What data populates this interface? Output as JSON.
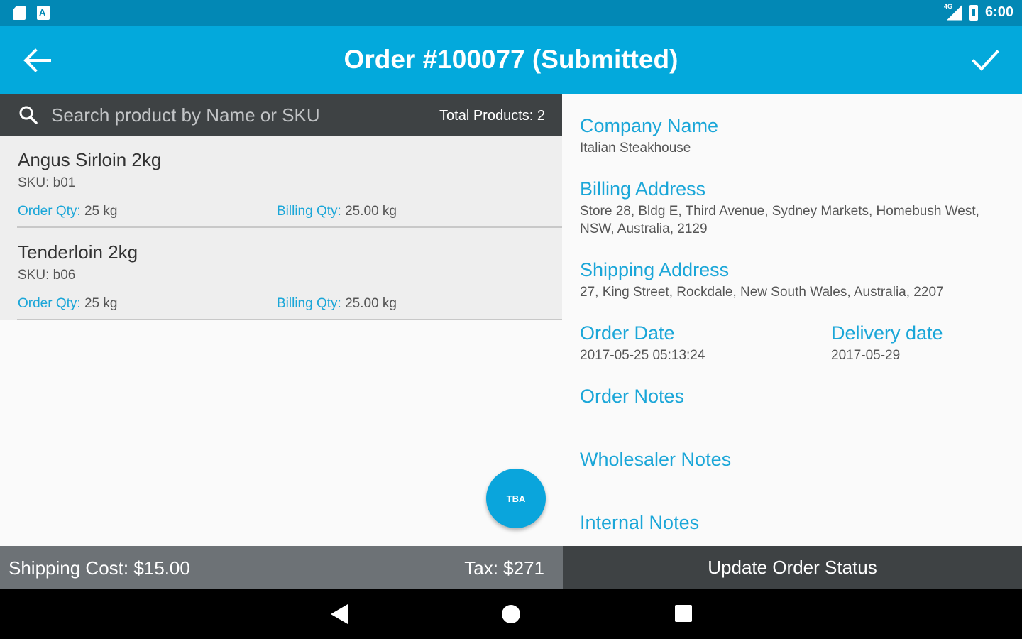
{
  "status_bar": {
    "time": "6:00",
    "signal_label": "4G"
  },
  "app_bar": {
    "title": "Order #100077 (Submitted)"
  },
  "search": {
    "placeholder": "Search product by Name or SKU",
    "total_products": "Total Products: 2"
  },
  "products": [
    {
      "name": "Angus Sirloin 2kg",
      "sku": "SKU: b01",
      "order_qty_label": "Order Qty:",
      "order_qty": " 25 kg",
      "billing_qty_label": "Billing Qty:",
      "billing_qty": " 25.00 kg"
    },
    {
      "name": "Tenderloin 2kg",
      "sku": "SKU: b06",
      "order_qty_label": "Order Qty:",
      "order_qty": " 25 kg",
      "billing_qty_label": "Billing Qty:",
      "billing_qty": " 25.00 kg"
    }
  ],
  "fab": {
    "label": "TBA"
  },
  "details": {
    "company_name_label": "Company Name",
    "company_name": "Italian Steakhouse",
    "billing_address_label": "Billing Address",
    "billing_address": "Store 28, Bldg E, Third Avenue,  Sydney Markets, Homebush West, NSW, Australia, 2129",
    "shipping_address_label": "Shipping Address",
    "shipping_address": "27, King Street, Rockdale, New South Wales, Australia, 2207",
    "order_date_label": "Order Date",
    "order_date": "2017-05-25 05:13:24",
    "delivery_date_label": "Delivery date",
    "delivery_date": "2017-05-29",
    "order_notes_label": "Order Notes",
    "wholesaler_notes_label": "Wholesaler Notes",
    "internal_notes_label": "Internal Notes"
  },
  "footer": {
    "shipping_cost": "Shipping Cost:  $15.00",
    "tax": "Tax:  $271",
    "update_status": "Update Order Status"
  },
  "colors": {
    "primary": "#03a9dc",
    "status_bar": "#0288b5",
    "accent_text": "#1aa6d8",
    "dark_bar": "#3e4244",
    "grey_bar": "#6d7276"
  }
}
